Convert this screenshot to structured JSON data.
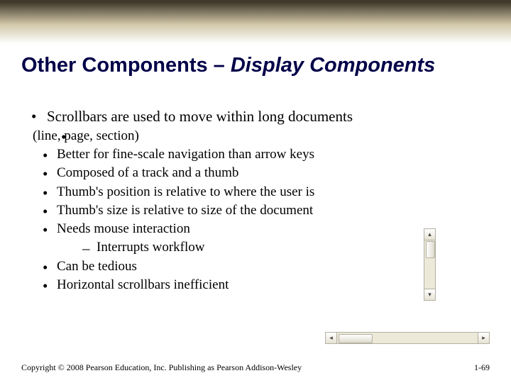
{
  "title_plain": "Other Components – ",
  "title_em": "Display Components",
  "bullets": {
    "b0": "Scrollbars are used to move within long documents",
    "b0_cont": "(line, page, section)",
    "b1": "Better for fine-scale navigation than arrow keys",
    "b2": "Composed of a track and a thumb",
    "b3": "Thumb's position is relative to where the user is",
    "b4": "Thumb's size is relative to size of the document",
    "b5": "Needs mouse interaction",
    "b5_sub": "Interrupts workflow",
    "b6": "Can be tedious",
    "b7": "Horizontal scrollbars inefficient"
  },
  "footer_left": "Copyright © 2008 Pearson Education, Inc. Publishing as Pearson Addison-Wesley",
  "footer_right": "1-69",
  "icons": {
    "up": "▴",
    "down": "▾",
    "left": "◂",
    "right": "▸"
  }
}
